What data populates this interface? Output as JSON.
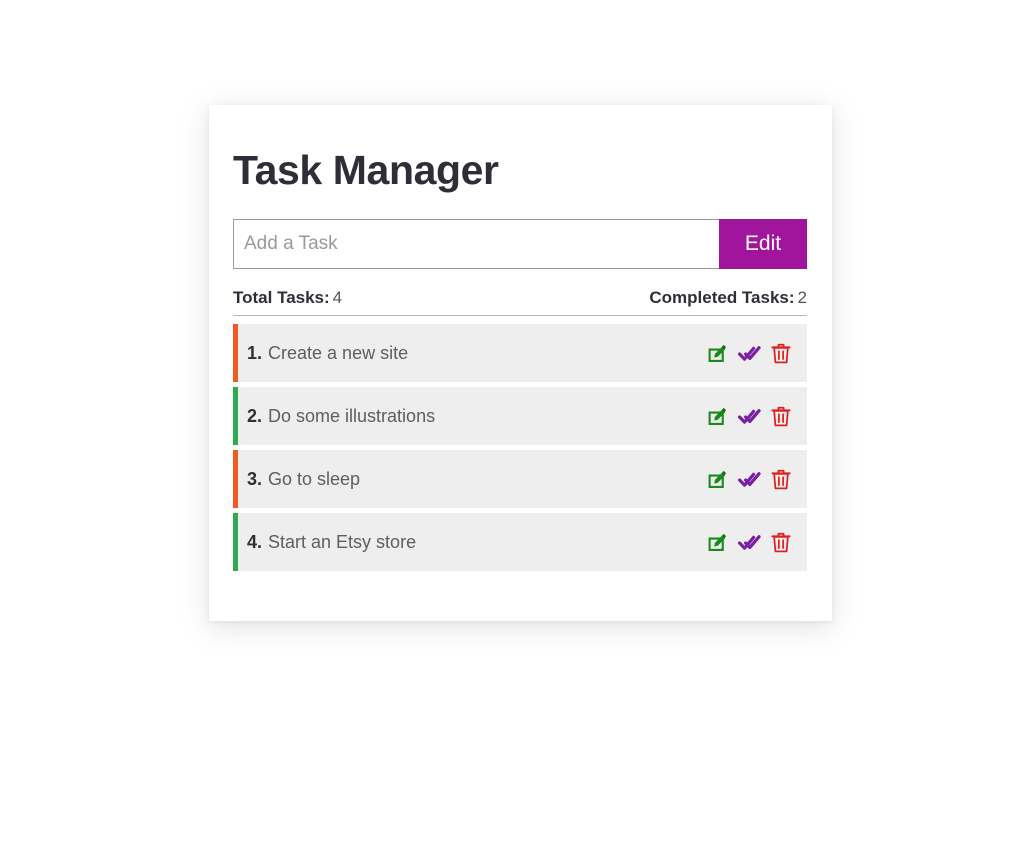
{
  "app": {
    "title": "Task Manager"
  },
  "add_task": {
    "placeholder": "Add a Task",
    "value": "",
    "button_label": "Edit"
  },
  "stats": {
    "total_label": "Total Tasks:",
    "total_value": "4",
    "completed_label": "Completed Tasks:",
    "completed_value": "2"
  },
  "actions": {
    "edit_icon": "edit-square-pencil-icon",
    "complete_icon": "double-check-icon",
    "delete_icon": "trash-icon"
  },
  "colors": {
    "accent_purple": "#a0159c",
    "edit_green": "#1a8a1a",
    "check_purple": "#7b1fa2",
    "delete_red": "#e02020",
    "accent_orange": "#f15a22",
    "accent_green": "#2eab52",
    "row_background": "#eeeeee",
    "title_color": "#2e2e38"
  },
  "tasks": [
    {
      "number": "1.",
      "text": "Create a new site",
      "accent": "#f15a22"
    },
    {
      "number": "2.",
      "text": "Do some illustrations",
      "accent": "#2eab52"
    },
    {
      "number": "3.",
      "text": "Go to sleep",
      "accent": "#f15a22"
    },
    {
      "number": "4.",
      "text": "Start an Etsy store",
      "accent": "#2eab52"
    }
  ]
}
